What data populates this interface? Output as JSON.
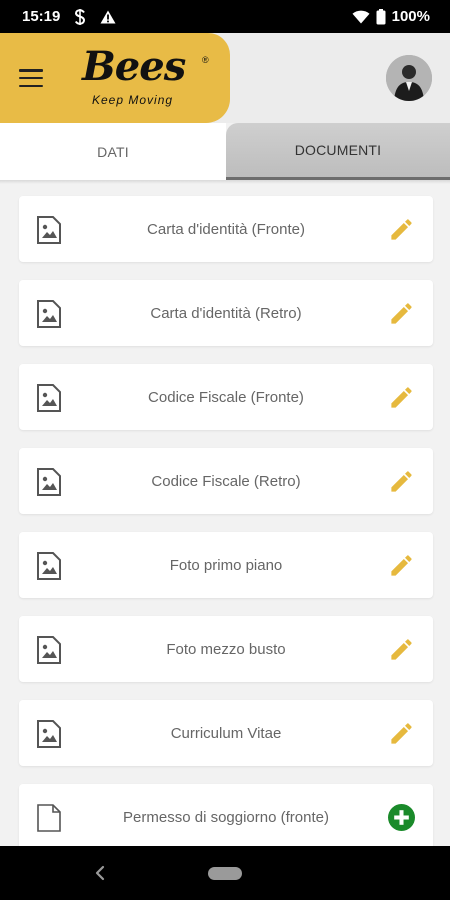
{
  "status_bar": {
    "time": "15:19",
    "battery": "100%",
    "icons": [
      "s-notification-icon",
      "warning-icon",
      "wifi-icon",
      "battery-icon"
    ]
  },
  "header": {
    "menu_icon": "hamburger-menu-icon",
    "logo_text": "Bees",
    "logo_registered": "®",
    "logo_tagline": "Keep Moving",
    "brand_color": "#e8bb46"
  },
  "tabs": [
    {
      "label": "DATI",
      "active": false
    },
    {
      "label": "DOCUMENTI",
      "active": true
    }
  ],
  "documents": [
    {
      "label": "Carta d'identità (Fronte)",
      "icon": "image-file-icon",
      "action": "edit-pencil-icon"
    },
    {
      "label": "Carta d'identità (Retro)",
      "icon": "image-file-icon",
      "action": "edit-pencil-icon"
    },
    {
      "label": "Codice Fiscale (Fronte)",
      "icon": "image-file-icon",
      "action": "edit-pencil-icon"
    },
    {
      "label": "Codice Fiscale (Retro)",
      "icon": "image-file-icon",
      "action": "edit-pencil-icon"
    },
    {
      "label": "Foto primo piano",
      "icon": "image-file-icon",
      "action": "edit-pencil-icon"
    },
    {
      "label": "Foto mezzo busto",
      "icon": "image-file-icon",
      "action": "edit-pencil-icon"
    },
    {
      "label": "Curriculum Vitae",
      "icon": "image-file-icon",
      "action": "edit-pencil-icon"
    },
    {
      "label": "Permesso di soggiorno (fronte)",
      "icon": "blank-file-icon",
      "action": "add-plus-icon"
    }
  ],
  "colors": {
    "accent": "#e8bb46",
    "pencil": "#e6b93e",
    "add_green": "#1a8a2a"
  }
}
